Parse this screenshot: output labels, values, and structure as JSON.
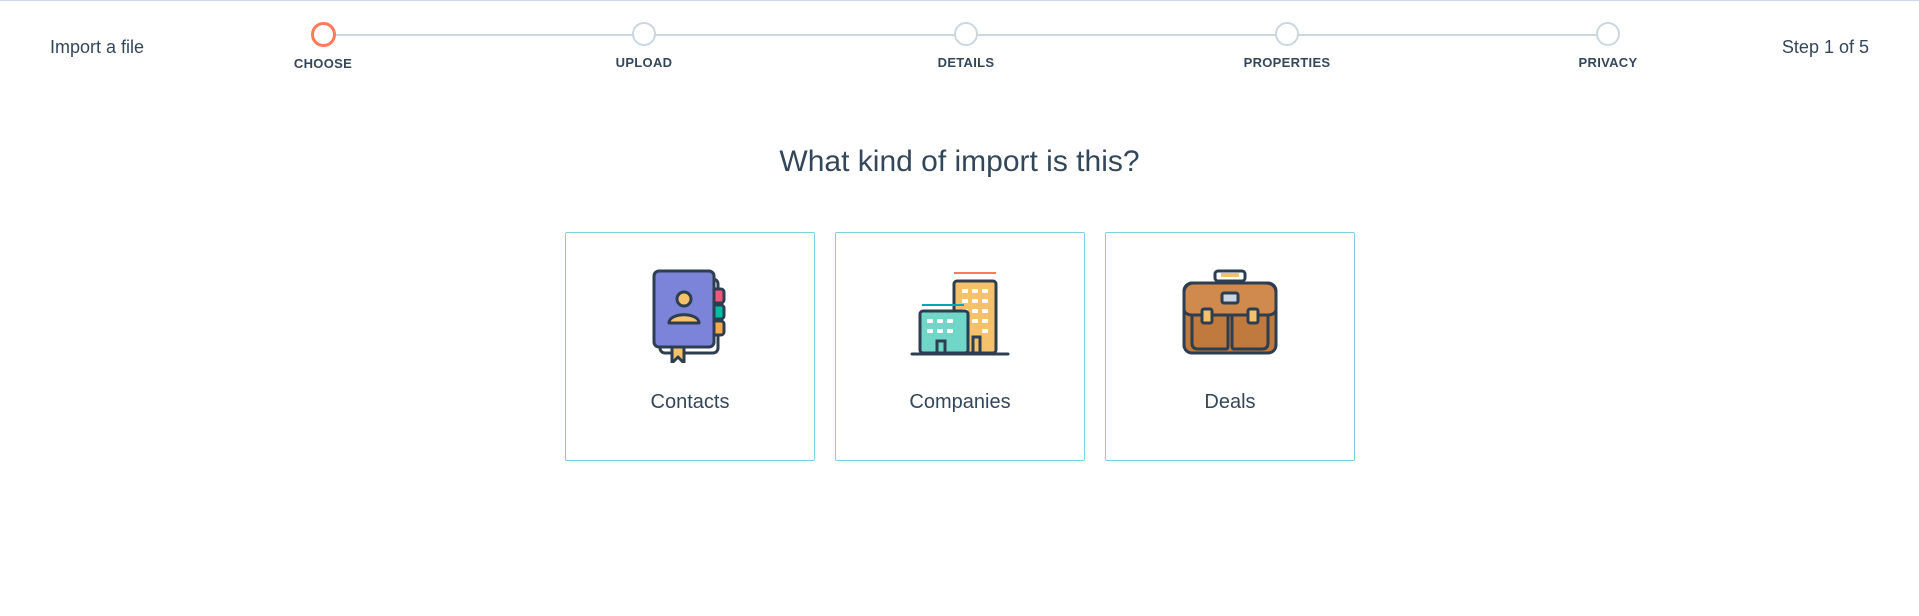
{
  "header": {
    "title": "Import a file",
    "step_indicator": "Step 1 of 5"
  },
  "stepper": {
    "steps": [
      {
        "label": "CHOOSE",
        "state": "active"
      },
      {
        "label": "UPLOAD",
        "state": "inactive"
      },
      {
        "label": "DETAILS",
        "state": "inactive"
      },
      {
        "label": "PROPERTIES",
        "state": "inactive"
      },
      {
        "label": "PRIVACY",
        "state": "inactive"
      }
    ],
    "active_color": "#ff7a59",
    "inactive_color": "#cbd6e2"
  },
  "main": {
    "question": "What kind of import is this?",
    "options": [
      {
        "label": "Contacts",
        "icon": "address-book-icon"
      },
      {
        "label": "Companies",
        "icon": "buildings-icon"
      },
      {
        "label": "Deals",
        "icon": "briefcase-icon"
      }
    ],
    "card_border_color": "#7fd1de"
  },
  "colors": {
    "text": "#33475b",
    "accent": "#ff7a59"
  }
}
